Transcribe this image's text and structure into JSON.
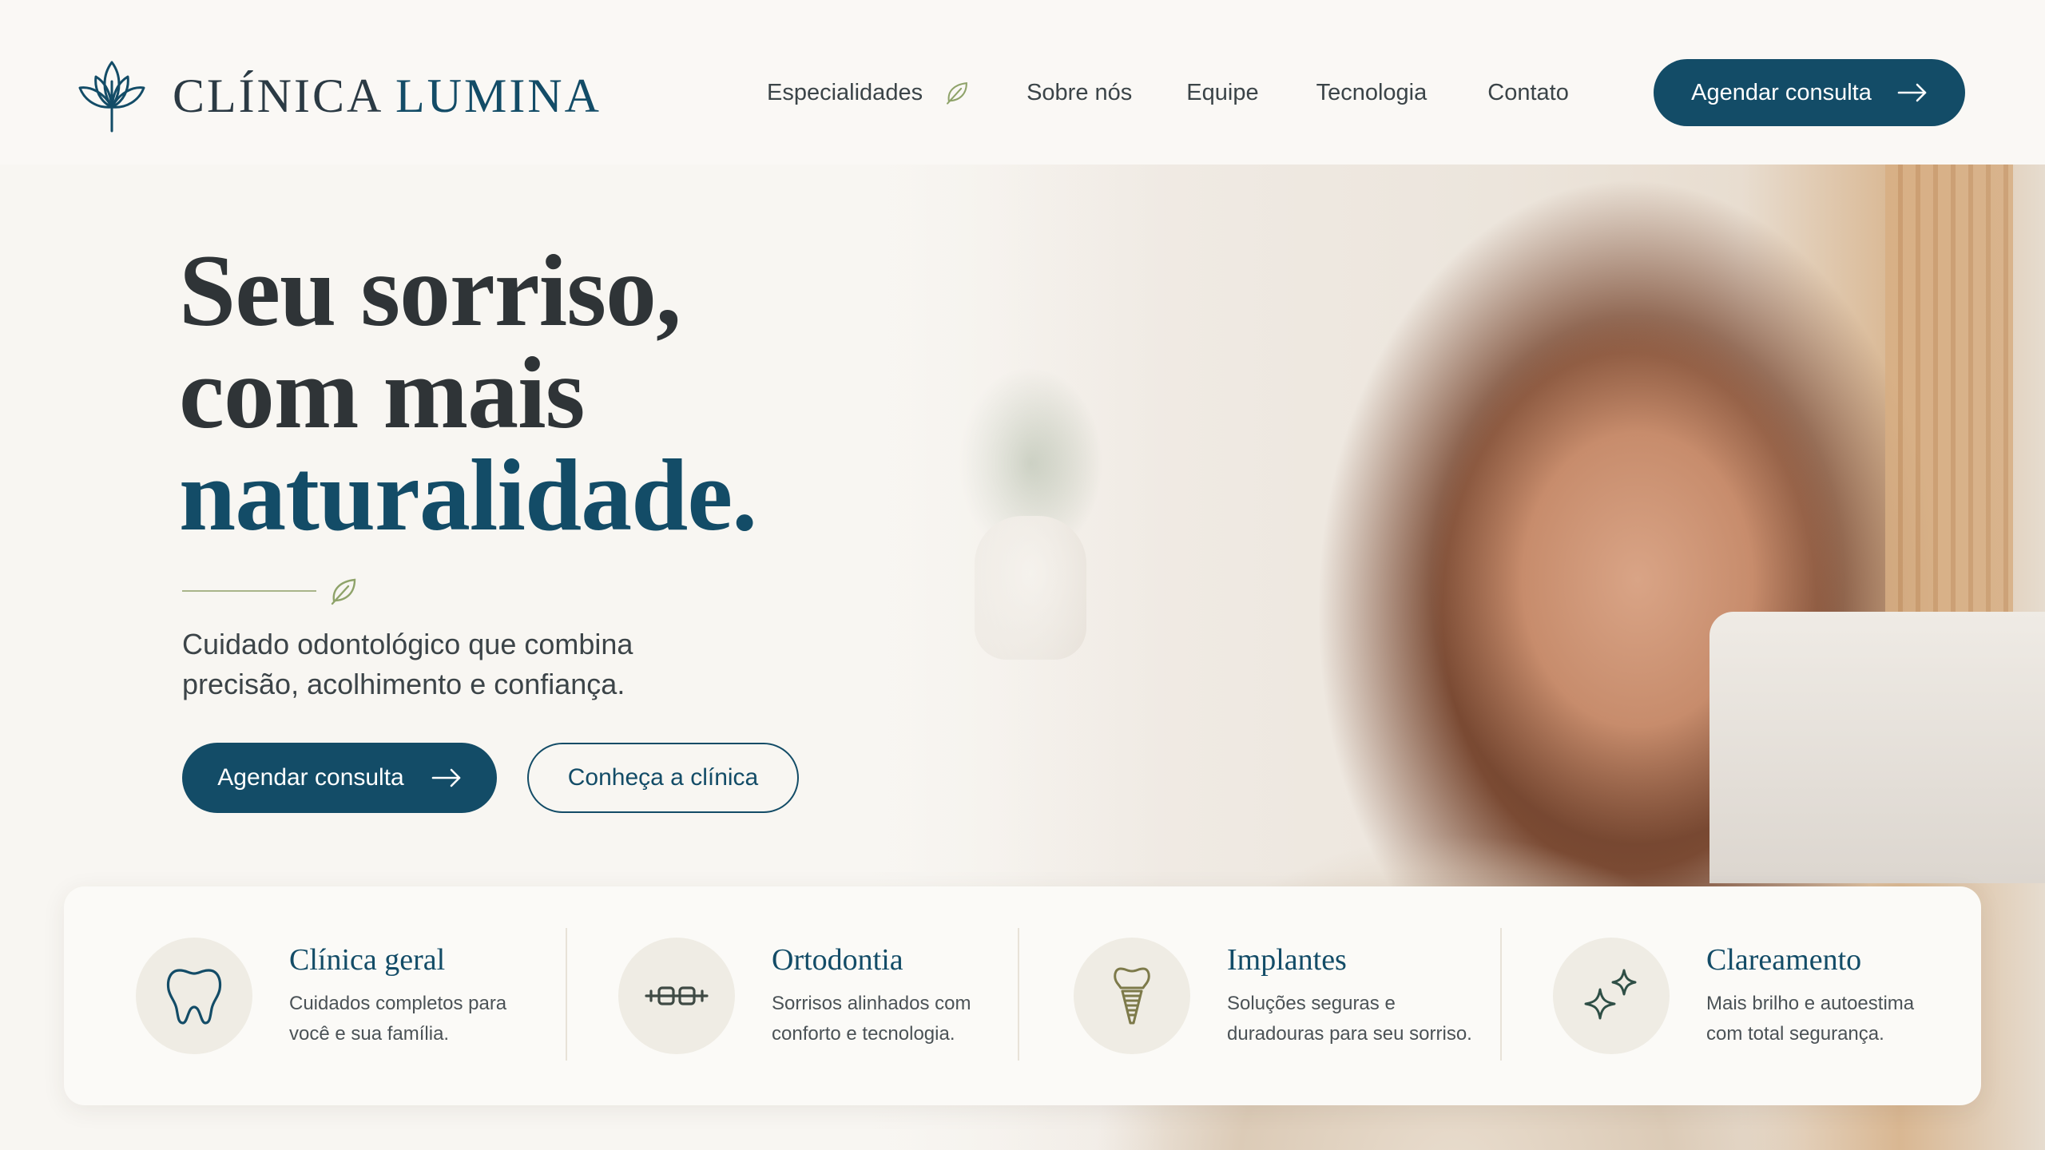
{
  "brand": {
    "name_part1": "CLÍNICA",
    "name_part2": "LUMINA"
  },
  "nav": {
    "items": [
      {
        "label": "Especialidades",
        "icon": "leaf-icon"
      },
      {
        "label": "Sobre nós"
      },
      {
        "label": "Equipe"
      },
      {
        "label": "Tecnologia"
      },
      {
        "label": "Contato"
      }
    ],
    "cta_label": "Agendar consulta"
  },
  "hero": {
    "title_line1": "Seu sorriso,",
    "title_line2": "com mais",
    "title_line3": "naturalidade.",
    "subtitle_line1": "Cuidado odontológico que combina",
    "subtitle_line2": "precisão, acolhimento e confiança.",
    "primary_button": "Agendar consulta",
    "secondary_button": "Conheça a clínica"
  },
  "services": [
    {
      "title": "Clínica geral",
      "desc_line1": "Cuidados completos para",
      "desc_line2": "você e sua família.",
      "icon": "tooth-icon"
    },
    {
      "title": "Ortodontia",
      "desc_line1": "Sorrisos alinhados com",
      "desc_line2": "conforto e tecnologia.",
      "icon": "braces-icon"
    },
    {
      "title": "Implantes",
      "desc_line1": "Soluções seguras e",
      "desc_line2": "duradouras para seu sorriso.",
      "icon": "implant-icon"
    },
    {
      "title": "Clareamento",
      "desc_line1": "Mais brilho e autoestima",
      "desc_line2": "com total segurança.",
      "icon": "sparkle-icon"
    }
  ],
  "colors": {
    "primary": "#134c67",
    "text": "#2f3437",
    "accent_leaf": "#8fa36a",
    "background": "#f8f6f2",
    "icon_circle": "#efece4"
  }
}
